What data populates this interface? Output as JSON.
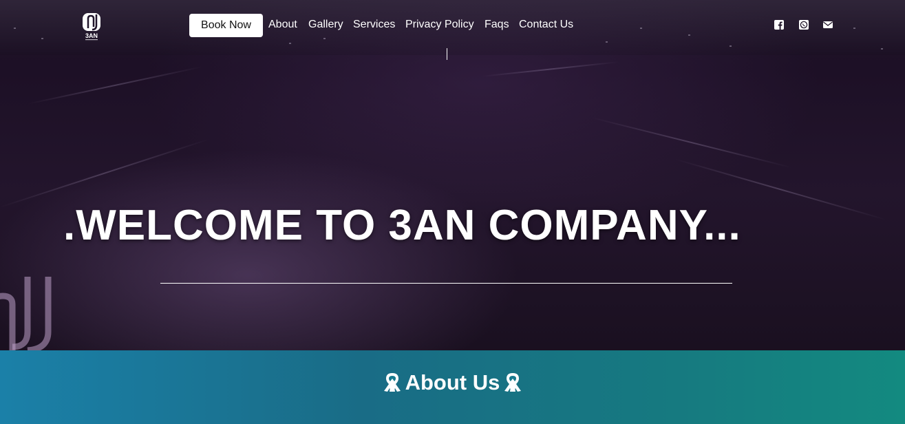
{
  "header": {
    "logo_alt": "3AN",
    "book_now": "Book Now",
    "nav": [
      "About",
      "Gallery",
      "Services",
      "Privacy Policy",
      "Faqs",
      "Contact Us"
    ],
    "social_icons": [
      "facebook-icon",
      "whatsapp-icon",
      "envelope-icon"
    ]
  },
  "hero": {
    "title": ".WELCOME TO 3AN COMPANY..."
  },
  "about": {
    "title": "About Us"
  },
  "colors": {
    "book_button_bg": "#ffffff",
    "nav_text": "#ffffff",
    "band_left": "#1b80a8",
    "band_right": "#138a80"
  }
}
